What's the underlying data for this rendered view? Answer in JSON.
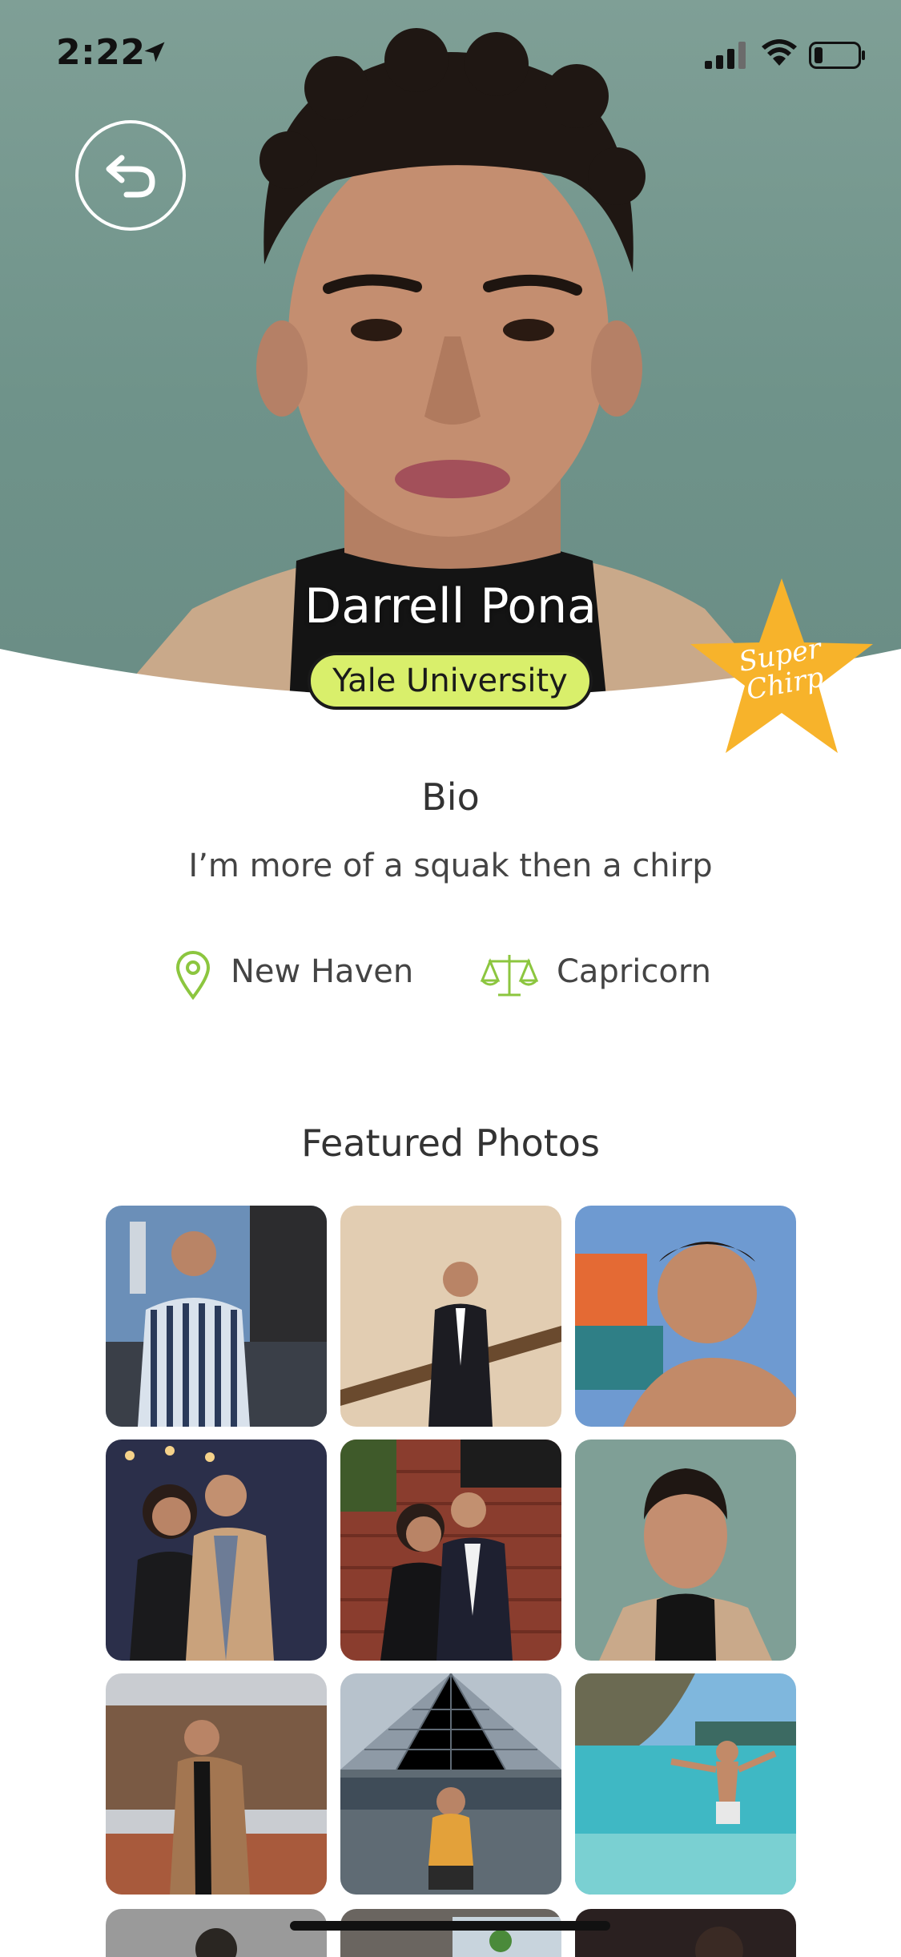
{
  "status_bar": {
    "time": "2:22"
  },
  "profile": {
    "name": "Darrell Pona",
    "school": "Yale University",
    "badge_line1": "Super",
    "badge_line2": "Chirp"
  },
  "bio": {
    "title": "Bio",
    "text": "I’m more of a squak then a chirp"
  },
  "details": {
    "location": "New Haven",
    "zodiac": "Capricorn"
  },
  "featured": {
    "title": "Featured Photos"
  },
  "colors": {
    "accent_green": "#8cc63f",
    "school_pill": "#d9ef6b",
    "star": "#f7b32b"
  }
}
